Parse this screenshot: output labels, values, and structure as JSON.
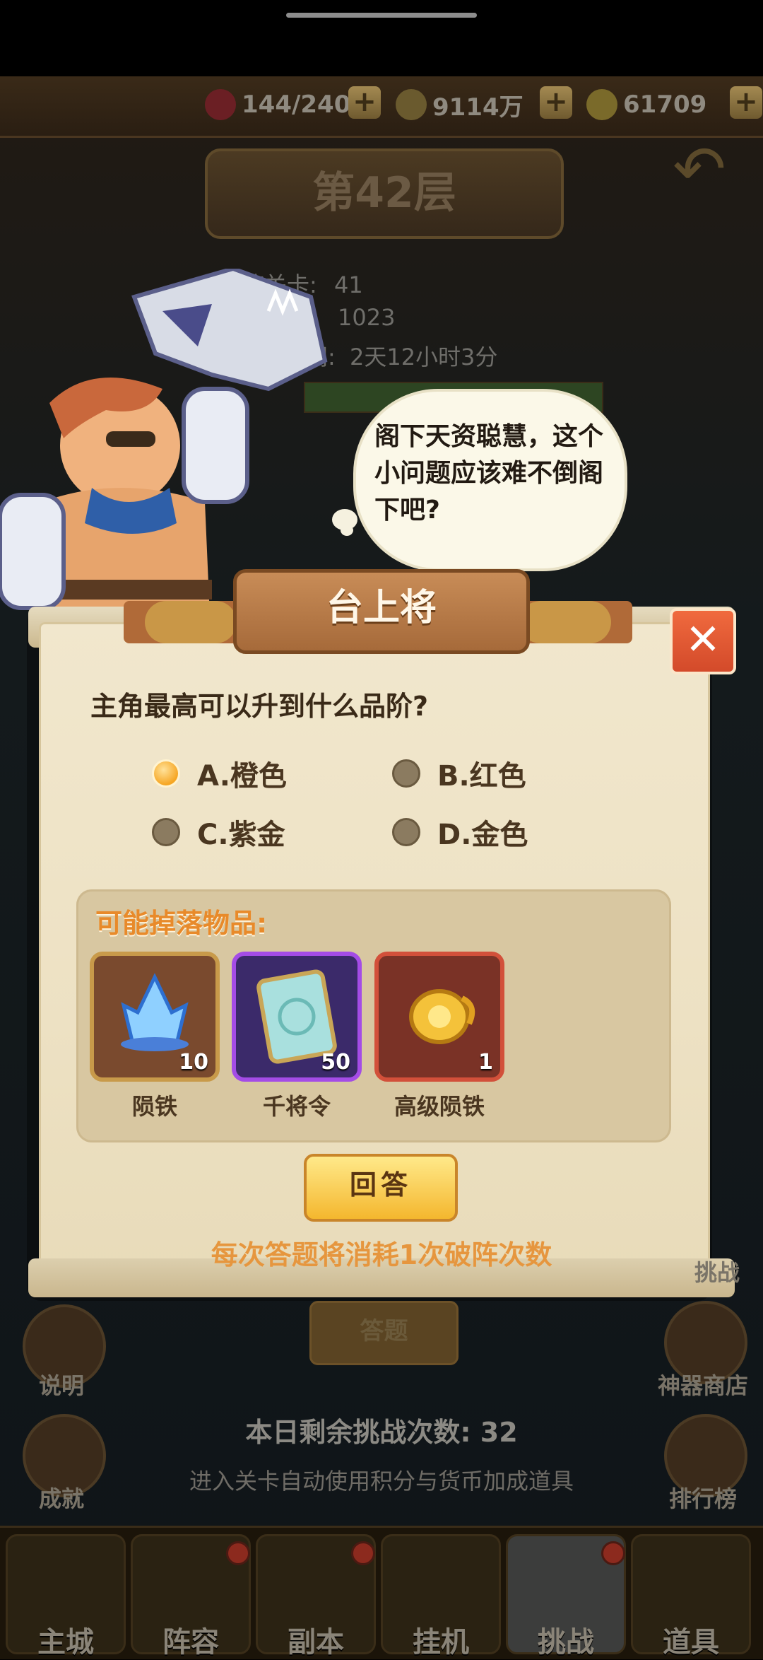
{
  "resources": {
    "stamina": "144/240",
    "gold": "9114万",
    "ingot": "61709",
    "plus": "+"
  },
  "floor": {
    "title": "第42层",
    "info_lines": [
      {
        "label": "破阵关卡:",
        "value": "41"
      },
      {
        "label": "",
        "value": "1023"
      },
      {
        "label": "关闭:",
        "value": "2天12小时3分"
      }
    ]
  },
  "npc": {
    "speech": "阁下天资聪慧，这个小问题应该难不倒阁下吧?"
  },
  "dialog": {
    "title": "台上将",
    "close": "✕",
    "question": "主角最高可以升到什么品阶?",
    "options": [
      {
        "label": "A.橙色",
        "selected": true
      },
      {
        "label": "B.红色",
        "selected": false
      },
      {
        "label": "C.紫金",
        "selected": false
      },
      {
        "label": "D.金色",
        "selected": false
      }
    ],
    "drops_title": "可能掉落物品:",
    "drops": [
      {
        "name": "陨铁",
        "count": "10",
        "frame_color": "#c89a4a",
        "icon": "blue-crystal-icon"
      },
      {
        "name": "千将令",
        "count": "50",
        "frame_color": "#a44ce6",
        "icon": "token-scroll-icon"
      },
      {
        "name": "高级陨铁",
        "count": "1",
        "frame_color": "#d2503a",
        "icon": "gold-ore-icon"
      }
    ],
    "answer_button": "回答",
    "cost_note": "每次答题将消耗1次破阵次数"
  },
  "scene": {
    "answer_tab": "答题",
    "left_buttons": [
      "说明",
      "成就"
    ],
    "right_buttons": [
      "挑战",
      "神器商店",
      "排行榜"
    ],
    "remaining": "本日剩余挑战次数:  32",
    "remaining_note": "进入关卡自动使用积分与货币加成道具"
  },
  "nav": {
    "items": [
      {
        "label": "主城",
        "active": false,
        "badge": false
      },
      {
        "label": "阵容",
        "active": false,
        "badge": true
      },
      {
        "label": "副本",
        "active": false,
        "badge": true
      },
      {
        "label": "挂机",
        "active": false,
        "badge": false
      },
      {
        "label": "挑战",
        "active": true,
        "badge": true
      },
      {
        "label": "道具",
        "active": false,
        "badge": false
      }
    ]
  },
  "colors": {
    "accent_orange": "#e88a2a",
    "close_red": "#d34a2a",
    "selected_radio": "#f6a623"
  }
}
